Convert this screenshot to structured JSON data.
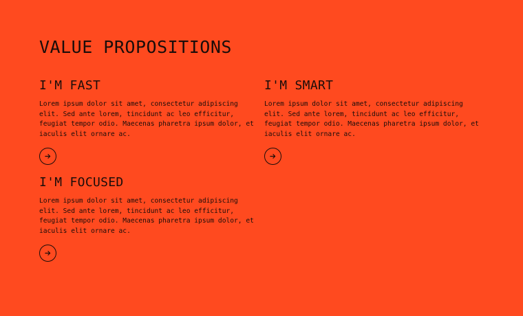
{
  "page": {
    "title": "VALUE PROPOSITIONS",
    "background": "#ff4a1f"
  },
  "cards": [
    {
      "heading": "I'M FAST",
      "body": "Lorem ipsum dolor sit amet, consectetur adipiscing elit. Sed ante lorem, tincidunt ac leo efficitur, feugiat tempor odio. Maecenas pharetra ipsum dolor, et iaculis elit ornare ac.",
      "button_icon": "arrow-right-icon"
    },
    {
      "heading": "I'M SMART",
      "body": "Lorem ipsum dolor sit amet, consectetur adipiscing elit. Sed ante lorem, tincidunt ac leo efficitur, feugiat tempor odio. Maecenas pharetra ipsum dolor, et iaculis elit ornare ac.",
      "button_icon": "arrow-right-icon"
    },
    {
      "heading": "I'M FOCUSED",
      "body": "Lorem ipsum dolor sit amet, consectetur adipiscing elit. Sed ante lorem, tincidunt ac leo efficitur, feugiat tempor odio. Maecenas pharetra ipsum dolor, et iaculis elit ornare ac.",
      "button_icon": "arrow-right-icon"
    }
  ]
}
